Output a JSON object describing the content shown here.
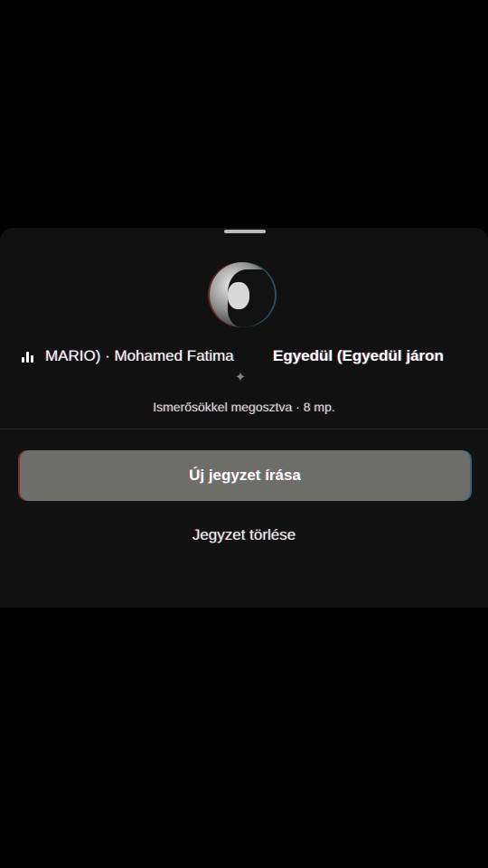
{
  "note_sheet": {
    "music": {
      "artist_text": "MARIO) · Mohamed Fatima",
      "song_title": "Egyedül (Egyedül járon"
    },
    "shared_text": "Ismerősökkel megosztva · 8 mp.",
    "new_note_label": "Új jegyzet írása",
    "delete_note_label": "Jegyzet törlése"
  },
  "icons": {
    "equalizer": "equalizer-icon",
    "bird": "bird-icon"
  },
  "colors": {
    "background": "#000000",
    "sheet": "#111111",
    "primary_button": "#6d6e69"
  }
}
